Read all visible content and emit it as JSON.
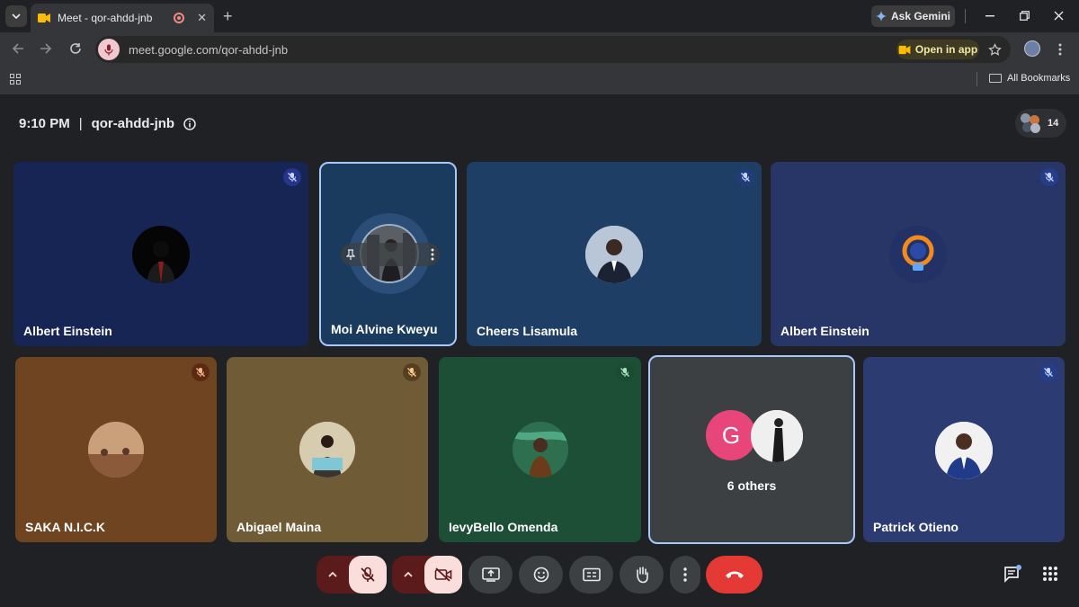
{
  "browser": {
    "tab_title": "Meet - qor-ahdd-jnb",
    "tab_close": "✕",
    "new_tab": "+",
    "gemini_label": "Ask Gemini",
    "url": "meet.google.com/qor-ahdd-jnb",
    "open_in_app": "Open in app",
    "all_bookmarks": "All Bookmarks"
  },
  "meeting": {
    "time": "9:10 PM",
    "separator": "|",
    "code": "qor-ahdd-jnb",
    "participant_count": "14"
  },
  "tiles": [
    {
      "name": "Albert Einstein"
    },
    {
      "name": "Moi Alvine Kweyu"
    },
    {
      "name": "Cheers Lisamula"
    },
    {
      "name": "Albert Einstein"
    },
    {
      "name": "SAKA N.I.C.K"
    },
    {
      "name": "Abigael Maina"
    },
    {
      "name": "IevyBello Omenda"
    },
    {
      "name": "6 others",
      "avatar_letter": "G"
    },
    {
      "name": "Patrick Otieno"
    }
  ],
  "colors": {
    "end_call": "#e53935",
    "muted_group": "#5c1b1b",
    "selected_border": "#a8c7fa"
  },
  "icons": [
    "mic-off-icon",
    "camera-off-icon",
    "present-icon",
    "emoji-icon",
    "captions-icon",
    "hand-icon",
    "more-icon",
    "end-call-icon",
    "chat-icon",
    "activities-icon"
  ]
}
